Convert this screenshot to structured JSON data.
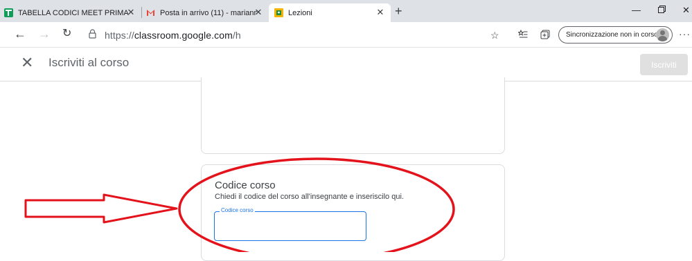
{
  "browser": {
    "tabs": [
      {
        "title": "TABELLA CODICI MEET PRIMARI...",
        "favicon": "sheets-icon"
      },
      {
        "title": "Posta in arrivo (11) - marianna.p...",
        "favicon": "gmail-icon"
      },
      {
        "title": "Lezioni",
        "favicon": "classroom-icon",
        "active": true
      }
    ],
    "address": {
      "scheme": "https://",
      "host": "classroom.google.com",
      "path": "/h"
    },
    "sync_label": "Sincronizzazione non in corso"
  },
  "app": {
    "header_title": "Iscriviti al corso",
    "join_button": "Iscriviti"
  },
  "course_code": {
    "title": "Codice corso",
    "subtitle": "Chiedi il codice del corso all'insegnante e inseriscilo qui.",
    "field_label": "Codice corso",
    "field_value": ""
  },
  "colors": {
    "accent": "#1a73e8",
    "annotation": "#e3121b",
    "sheets_green": "#0f9d58",
    "gmail_red": "#ea4335",
    "classroom_yellow": "#f4b400"
  }
}
